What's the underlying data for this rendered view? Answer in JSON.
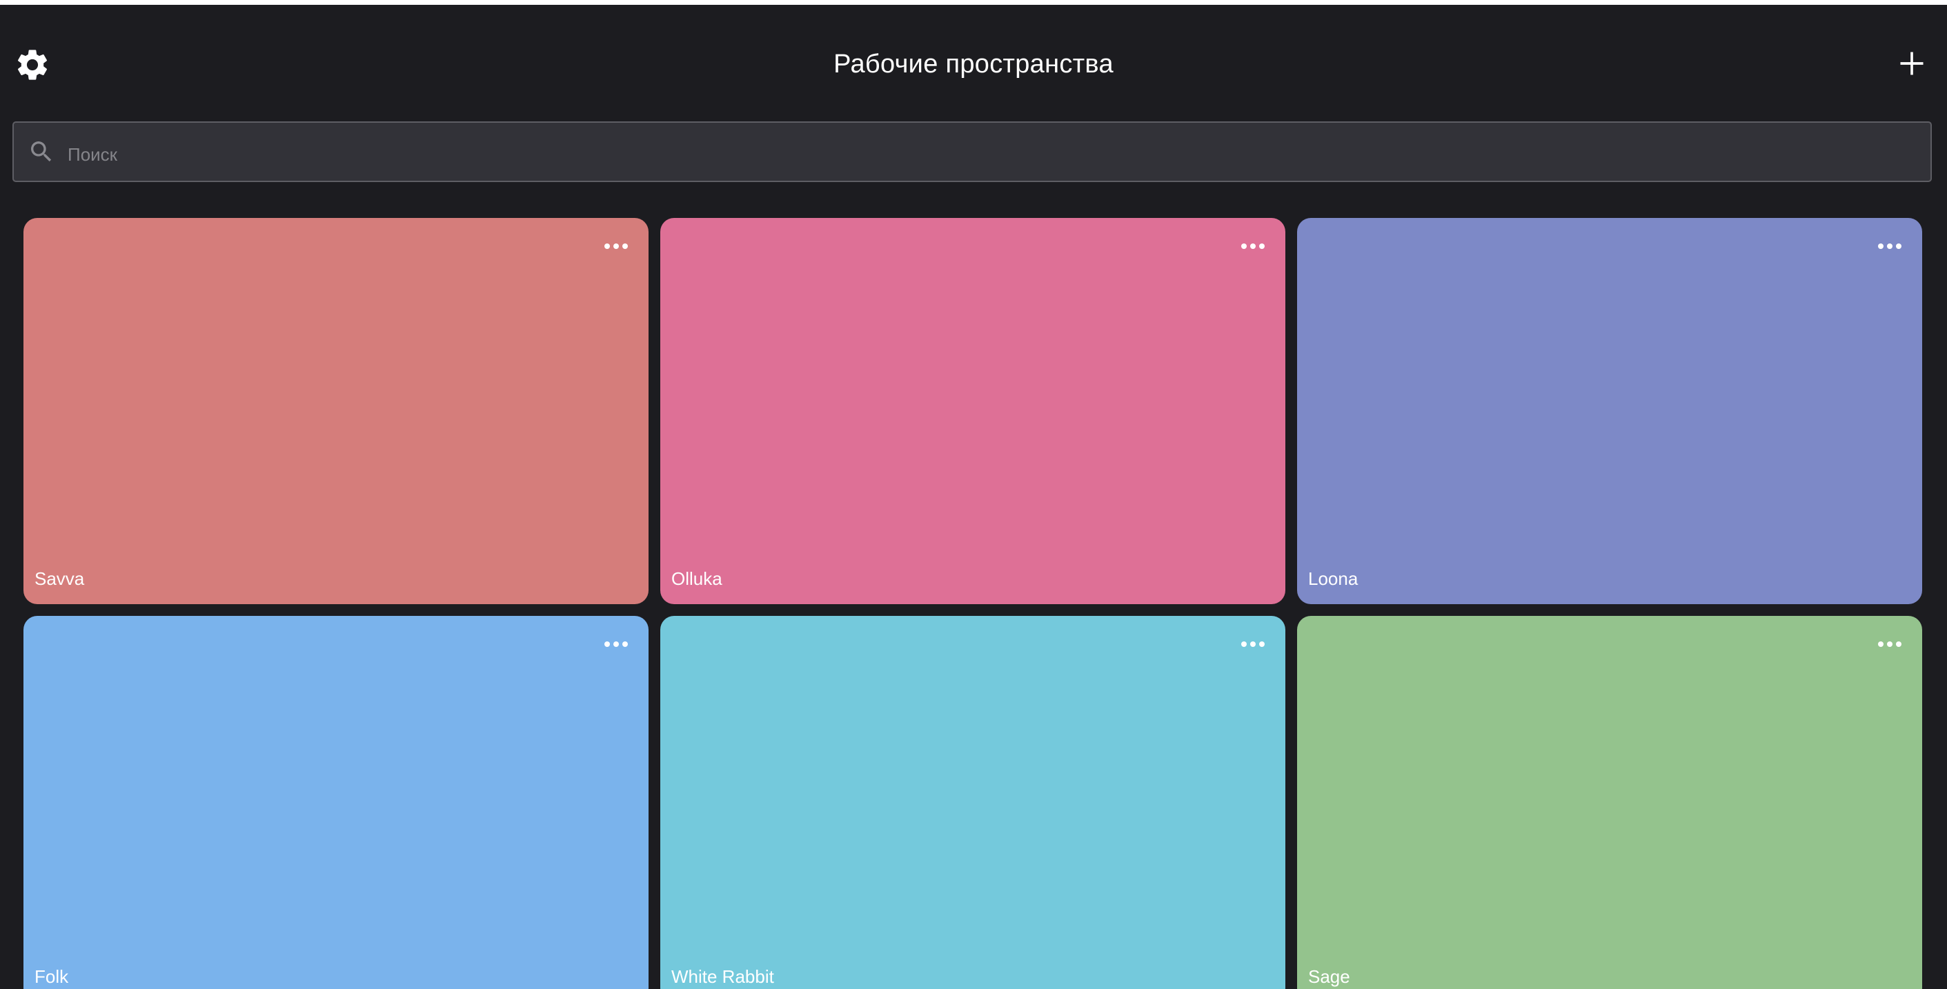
{
  "header": {
    "title": "Рабочие пространства",
    "settings_icon": "gear-icon",
    "add_icon": "plus-icon"
  },
  "search": {
    "placeholder": "Поиск",
    "value": "",
    "icon": "search-icon"
  },
  "workspaces": [
    {
      "name": "Savva",
      "color": "#d57d7b"
    },
    {
      "name": "Olluka",
      "color": "#de7096"
    },
    {
      "name": "Loona",
      "color": "#7d89c7"
    },
    {
      "name": "Folk",
      "color": "#7ab3ec"
    },
    {
      "name": "White Rabbit",
      "color": "#74c9dc"
    },
    {
      "name": "Sage",
      "color": "#94c38d"
    }
  ],
  "card_menu_icon": "more-horizontal-icon"
}
